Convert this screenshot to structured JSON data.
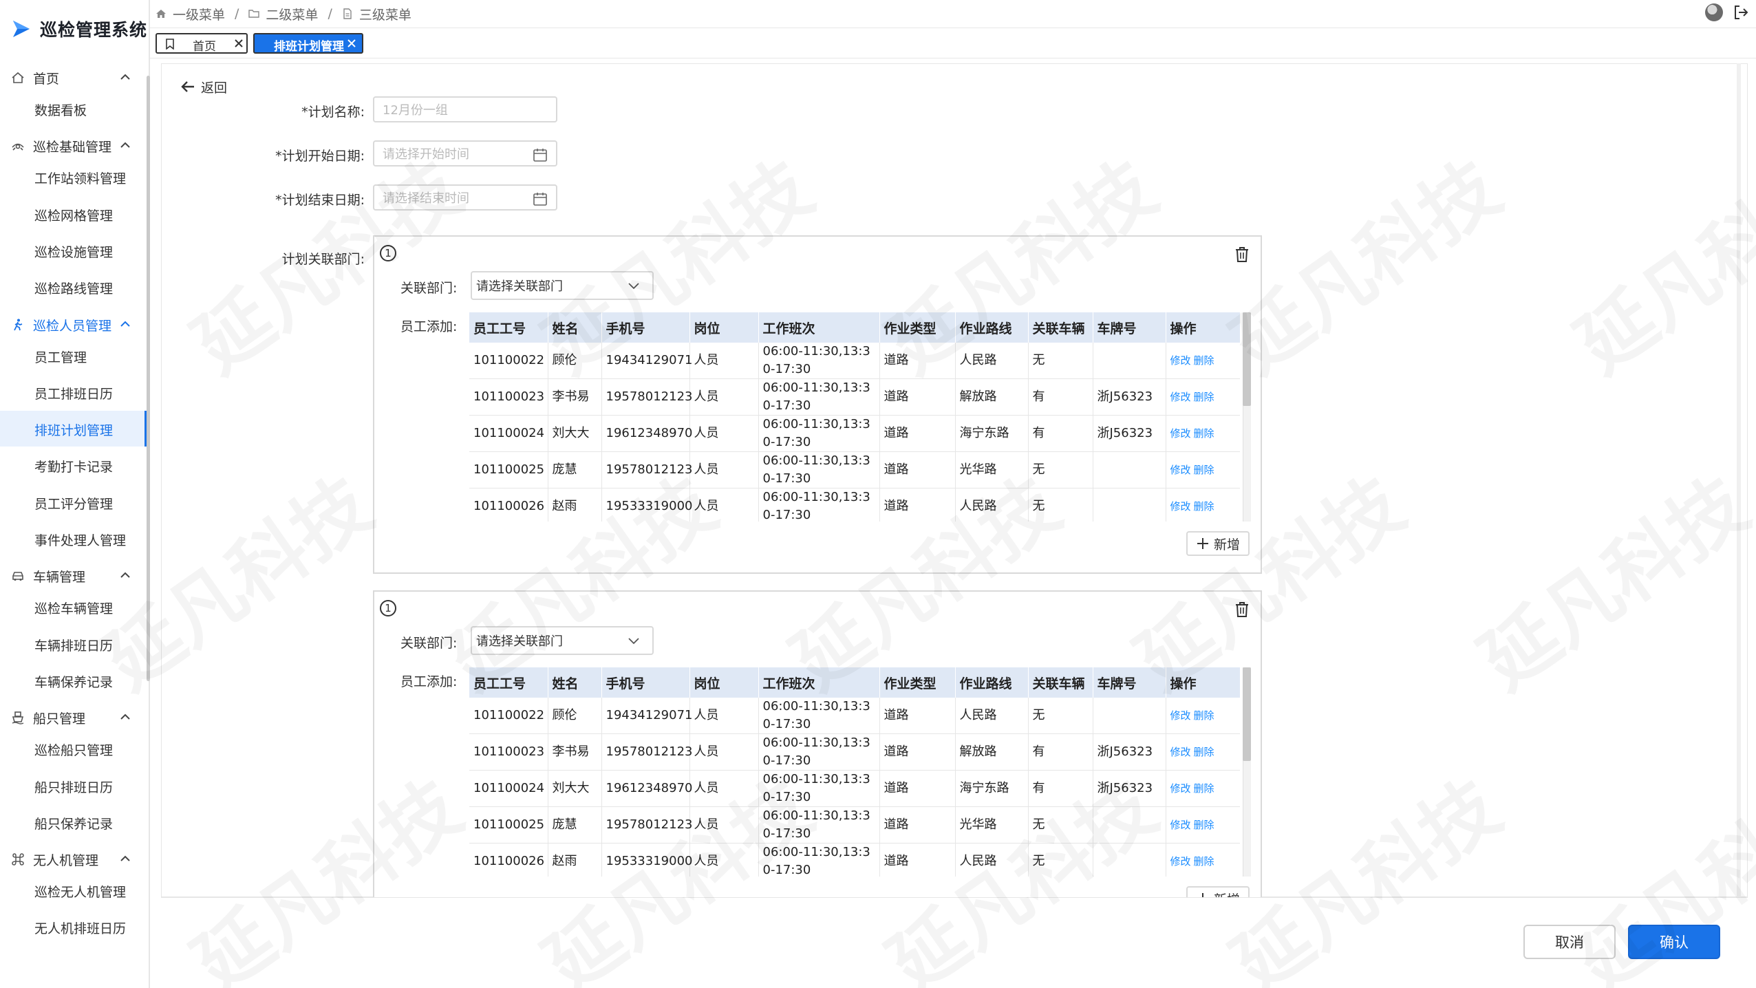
{
  "app": {
    "title": "巡检管理系统"
  },
  "breadcrumb": [
    "一级菜单",
    "二级菜单",
    "三级菜单"
  ],
  "tabs": [
    {
      "label": "首页"
    },
    {
      "label": "排班计划管理"
    }
  ],
  "sidebar": {
    "groups": [
      {
        "label": "首页",
        "icon": "home-icon",
        "items": [
          "数据看板"
        ]
      },
      {
        "label": "巡检基础管理",
        "icon": "eye-icon",
        "items": [
          "工作站领料管理",
          "巡检网格管理",
          "巡检设施管理",
          "巡检路线管理"
        ]
      },
      {
        "label": "巡检人员管理",
        "icon": "walking-person-icon",
        "items": [
          "员工管理",
          "员工排班日历",
          "排班计划管理",
          "考勤打卡记录",
          "员工评分管理",
          "事件处理人管理"
        ]
      },
      {
        "label": "车辆管理",
        "icon": "car-icon",
        "items": [
          "巡检车辆管理",
          "车辆排班日历",
          "车辆保养记录"
        ]
      },
      {
        "label": "船只管理",
        "icon": "ship-icon",
        "items": [
          "巡检船只管理",
          "船只排班日历",
          "船只保养记录"
        ]
      },
      {
        "label": "无人机管理",
        "icon": "command-icon",
        "items": [
          "巡检无人机管理",
          "无人机排班日历"
        ]
      }
    ],
    "active_item": "排班计划管理"
  },
  "form": {
    "back_label": "返回",
    "plan_name_label": "*计划名称:",
    "plan_name_value": "12月份一组",
    "start_date_label": "*计划开始日期:",
    "start_date_placeholder": "请选择开始时间",
    "end_date_label": "*计划结束日期:",
    "end_date_placeholder": "请选择结束时间",
    "dept_section_label": "计划关联部门:"
  },
  "panels": [
    {
      "index": "1",
      "dept_label": "关联部门:",
      "dept_placeholder": "请选择关联部门",
      "staff_label": "员工添加:",
      "add_label": "新增"
    },
    {
      "index": "1",
      "dept_label": "关联部门:",
      "dept_placeholder": "请选择关联部门",
      "staff_label": "员工添加:",
      "add_label": "新增"
    }
  ],
  "table": {
    "headers": [
      "员工工号",
      "姓名",
      "手机号",
      "岗位",
      "工作班次",
      "作业类型",
      "作业路线",
      "关联车辆",
      "车牌号",
      "操作"
    ],
    "rows": [
      [
        "101100022",
        "顾伦",
        "19434129071",
        "人员",
        "06:00-11:30,13:30-17:30",
        "道路",
        "人民路",
        "无",
        ""
      ],
      [
        "101100023",
        "李书易",
        "19578012123",
        "人员",
        "06:00-11:30,13:30-17:30",
        "道路",
        "解放路",
        "有",
        "浙J56323"
      ],
      [
        "101100024",
        "刘大大",
        "19612348970",
        "人员",
        "06:00-11:30,13:30-17:30",
        "道路",
        "海宁东路",
        "有",
        "浙J56323"
      ],
      [
        "101100025",
        "庞慧",
        "19578012123",
        "人员",
        "06:00-11:30,13:30-17:30",
        "道路",
        "光华路",
        "无",
        ""
      ],
      [
        "101100026",
        "赵雨",
        "19533319000",
        "人员",
        "06:00-11:30,13:30-17:30",
        "道路",
        "人民路",
        "无",
        ""
      ]
    ],
    "edit_label": "修改",
    "delete_label": "删除"
  },
  "footer": {
    "cancel_label": "取消",
    "confirm_label": "确认"
  },
  "watermark": "延凡科技",
  "colors": {
    "primary": "#1a73e8",
    "link": "#1a8cff",
    "table_header": "#dfe8f5"
  }
}
